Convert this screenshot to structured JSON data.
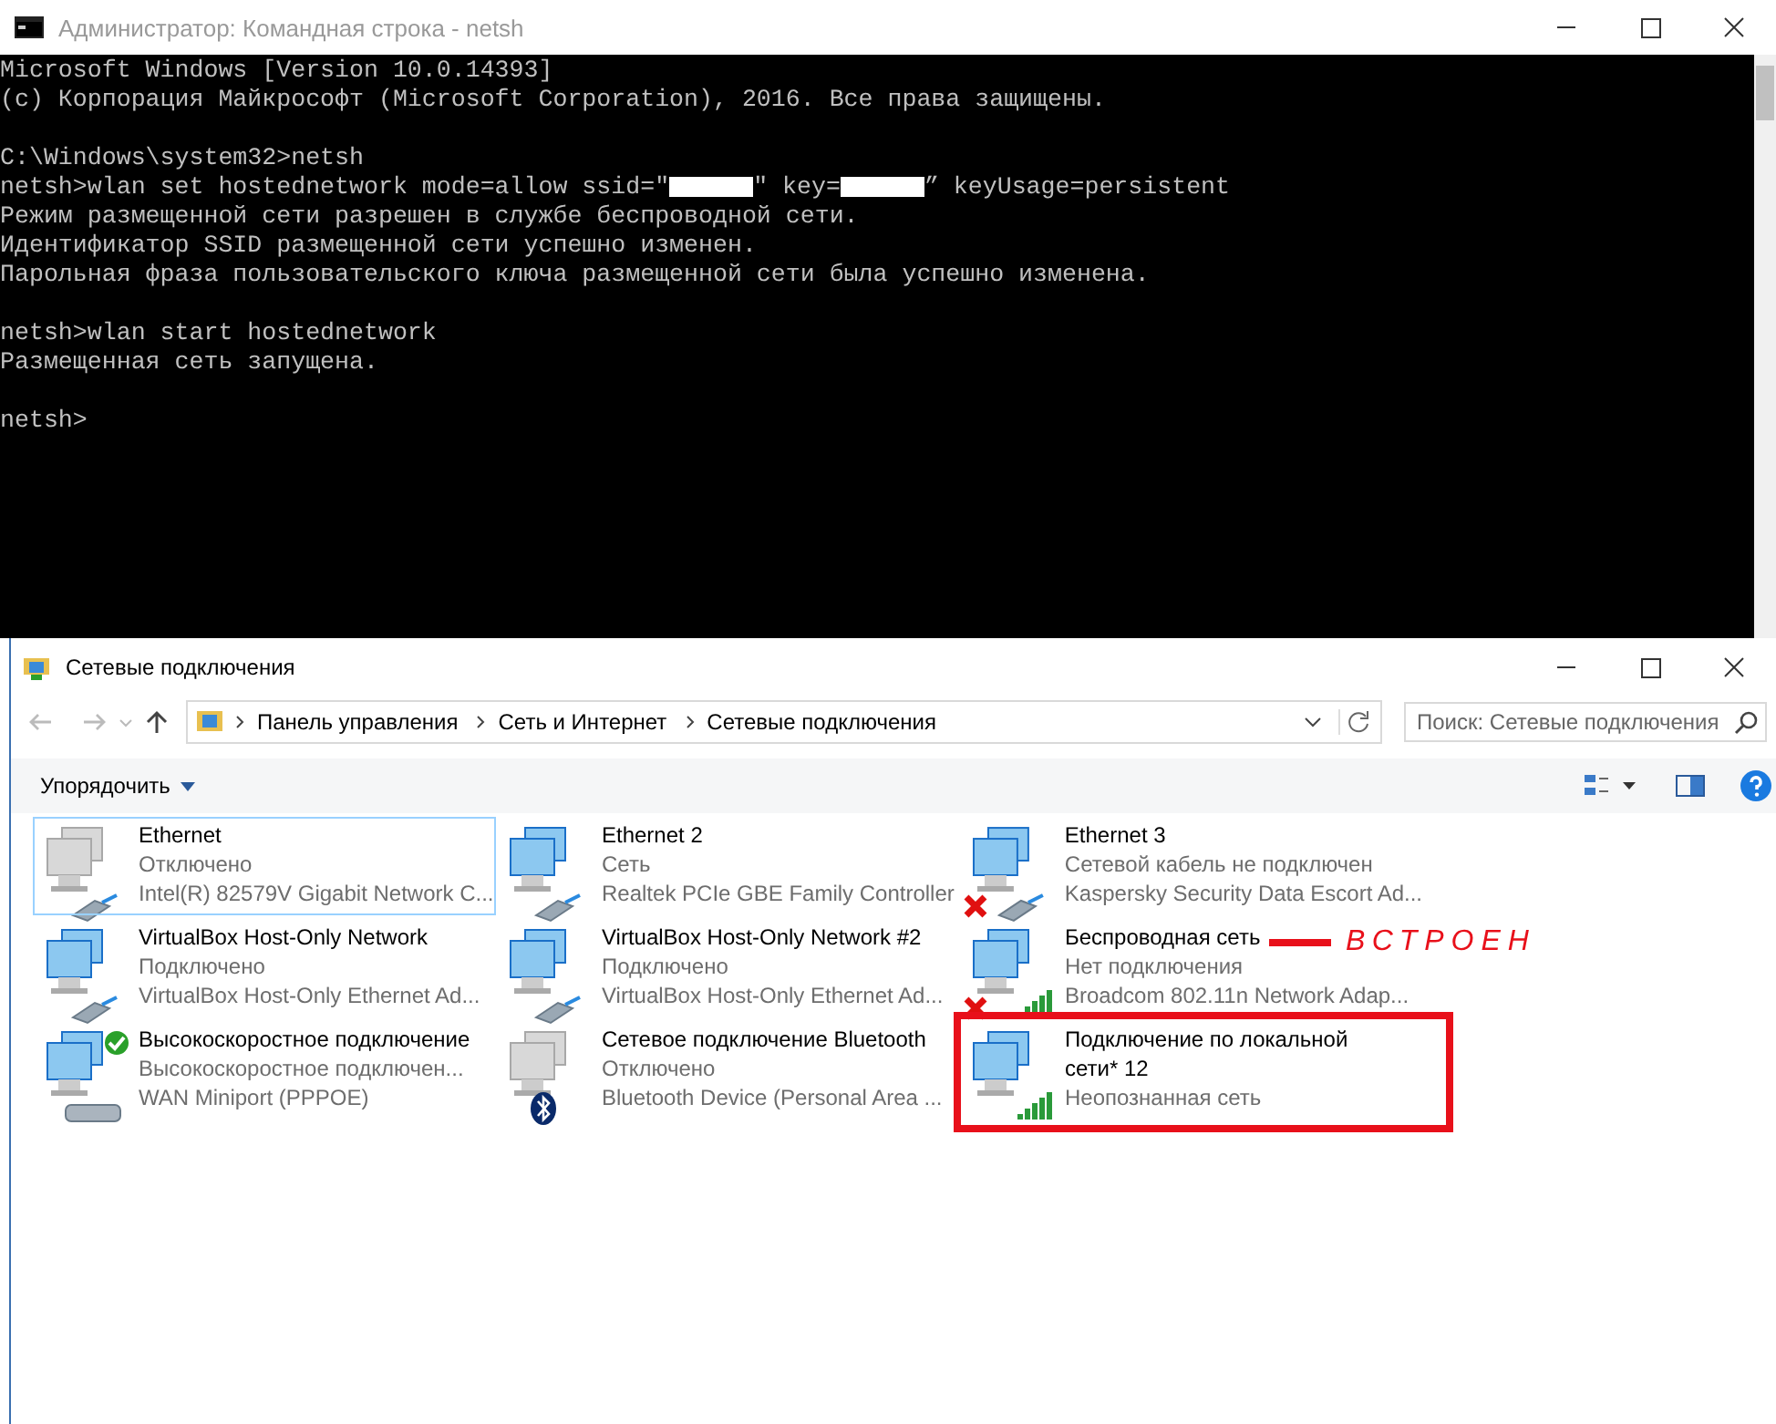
{
  "console_window": {
    "title": "Администратор: Командная строка - netsh",
    "lines": [
      {
        "kind": "text",
        "parts": [
          {
            "kind": "text",
            "text": "Microsoft Windows [Version 10.0.14393]"
          }
        ]
      },
      {
        "kind": "text",
        "parts": [
          {
            "kind": "text",
            "text": "(c) Корпорация Майкрософт (Microsoft Corporation), 2016. Все права защищены."
          }
        ]
      },
      {
        "kind": "blank"
      },
      {
        "kind": "text",
        "parts": [
          {
            "kind": "text",
            "text": "C:\\Windows\\system32>netsh"
          }
        ]
      },
      {
        "kind": "text",
        "parts": [
          {
            "kind": "text",
            "text": "netsh>wlan set hostednetwork mode=allow ssid=\""
          },
          {
            "kind": "redaction"
          },
          {
            "kind": "text",
            "text": "\" key="
          },
          {
            "kind": "redaction"
          },
          {
            "kind": "text",
            "text": "” keyUsage=persistent"
          }
        ]
      },
      {
        "kind": "text",
        "parts": [
          {
            "kind": "text",
            "text": "Режим размещенной сети разрешен в службе беспроводной сети."
          }
        ]
      },
      {
        "kind": "text",
        "parts": [
          {
            "kind": "text",
            "text": "Идентификатор SSID размещенной сети успешно изменен."
          }
        ]
      },
      {
        "kind": "text",
        "parts": [
          {
            "kind": "text",
            "text": "Парольная фраза пользовательского ключа размещенной сети была успешно изменена."
          }
        ]
      },
      {
        "kind": "blank"
      },
      {
        "kind": "text",
        "parts": [
          {
            "kind": "text",
            "text": "netsh>wlan start hostednetwork"
          }
        ]
      },
      {
        "kind": "text",
        "parts": [
          {
            "kind": "text",
            "text": "Размещенная сеть запущена."
          }
        ]
      },
      {
        "kind": "blank"
      },
      {
        "kind": "text",
        "parts": [
          {
            "kind": "text",
            "text": "netsh>"
          }
        ]
      }
    ]
  },
  "explorer_window": {
    "title": "Сетевые подключения",
    "breadcrumb": [
      "Панель управления",
      "Сеть и Интернет",
      "Сетевые подключения"
    ],
    "search": {
      "placeholder": "Поиск: Сетевые подключения"
    },
    "toolbar": {
      "organize": "Упорядочить"
    },
    "connections": [
      {
        "name": "Ethernet",
        "status": "Отключено",
        "device": "Intel(R) 82579V Gigabit Network C...",
        "kind": "cable",
        "disabled": true,
        "error": false,
        "connected": false,
        "selected": true,
        "highlighted": false
      },
      {
        "name": "Ethernet 2",
        "status": "Сеть",
        "device": "Realtek PCIe GBE Family Controller",
        "kind": "cable",
        "disabled": false,
        "error": false,
        "connected": false,
        "selected": false,
        "highlighted": false
      },
      {
        "name": "Ethernet 3",
        "status": "Сетевой кабель не подключен",
        "device": "Kaspersky Security Data Escort Ad...",
        "kind": "cable",
        "disabled": false,
        "error": true,
        "connected": false,
        "selected": false,
        "highlighted": false
      },
      {
        "name": "VirtualBox Host-Only Network",
        "status": "Подключено",
        "device": "VirtualBox Host-Only Ethernet Ad...",
        "kind": "cable",
        "disabled": false,
        "error": false,
        "connected": false,
        "selected": false,
        "highlighted": false
      },
      {
        "name": "VirtualBox Host-Only Network #2",
        "status": "Подключено",
        "device": "VirtualBox Host-Only Ethernet Ad...",
        "kind": "cable",
        "disabled": false,
        "error": false,
        "connected": false,
        "selected": false,
        "highlighted": false
      },
      {
        "name": "Беспроводная сеть",
        "status": "Нет подключения",
        "device": "Broadcom 802.11n Network Adap...",
        "kind": "wireless",
        "disabled": false,
        "error": true,
        "connected": false,
        "selected": false,
        "highlighted": false,
        "annotation": "ВСТРОЕН"
      },
      {
        "name": "Высокоскоростное подключение",
        "status": "Высокоскоростное подключен...",
        "device": "WAN Miniport (PPPOE)",
        "kind": "modem",
        "disabled": false,
        "error": false,
        "connected": true,
        "selected": false,
        "highlighted": false
      },
      {
        "name": "Сетевое подключение Bluetooth",
        "status": "Отключено",
        "device": "Bluetooth Device (Personal Area ...",
        "kind": "bluetooth",
        "disabled": true,
        "error": false,
        "connected": false,
        "selected": false,
        "highlighted": false
      },
      {
        "name": "Подключение по локальной сети* 12",
        "status": "Неопознанная сеть",
        "kind": "wireless",
        "disabled": false,
        "error": false,
        "connected": false,
        "selected": false,
        "highlighted": true
      }
    ]
  }
}
